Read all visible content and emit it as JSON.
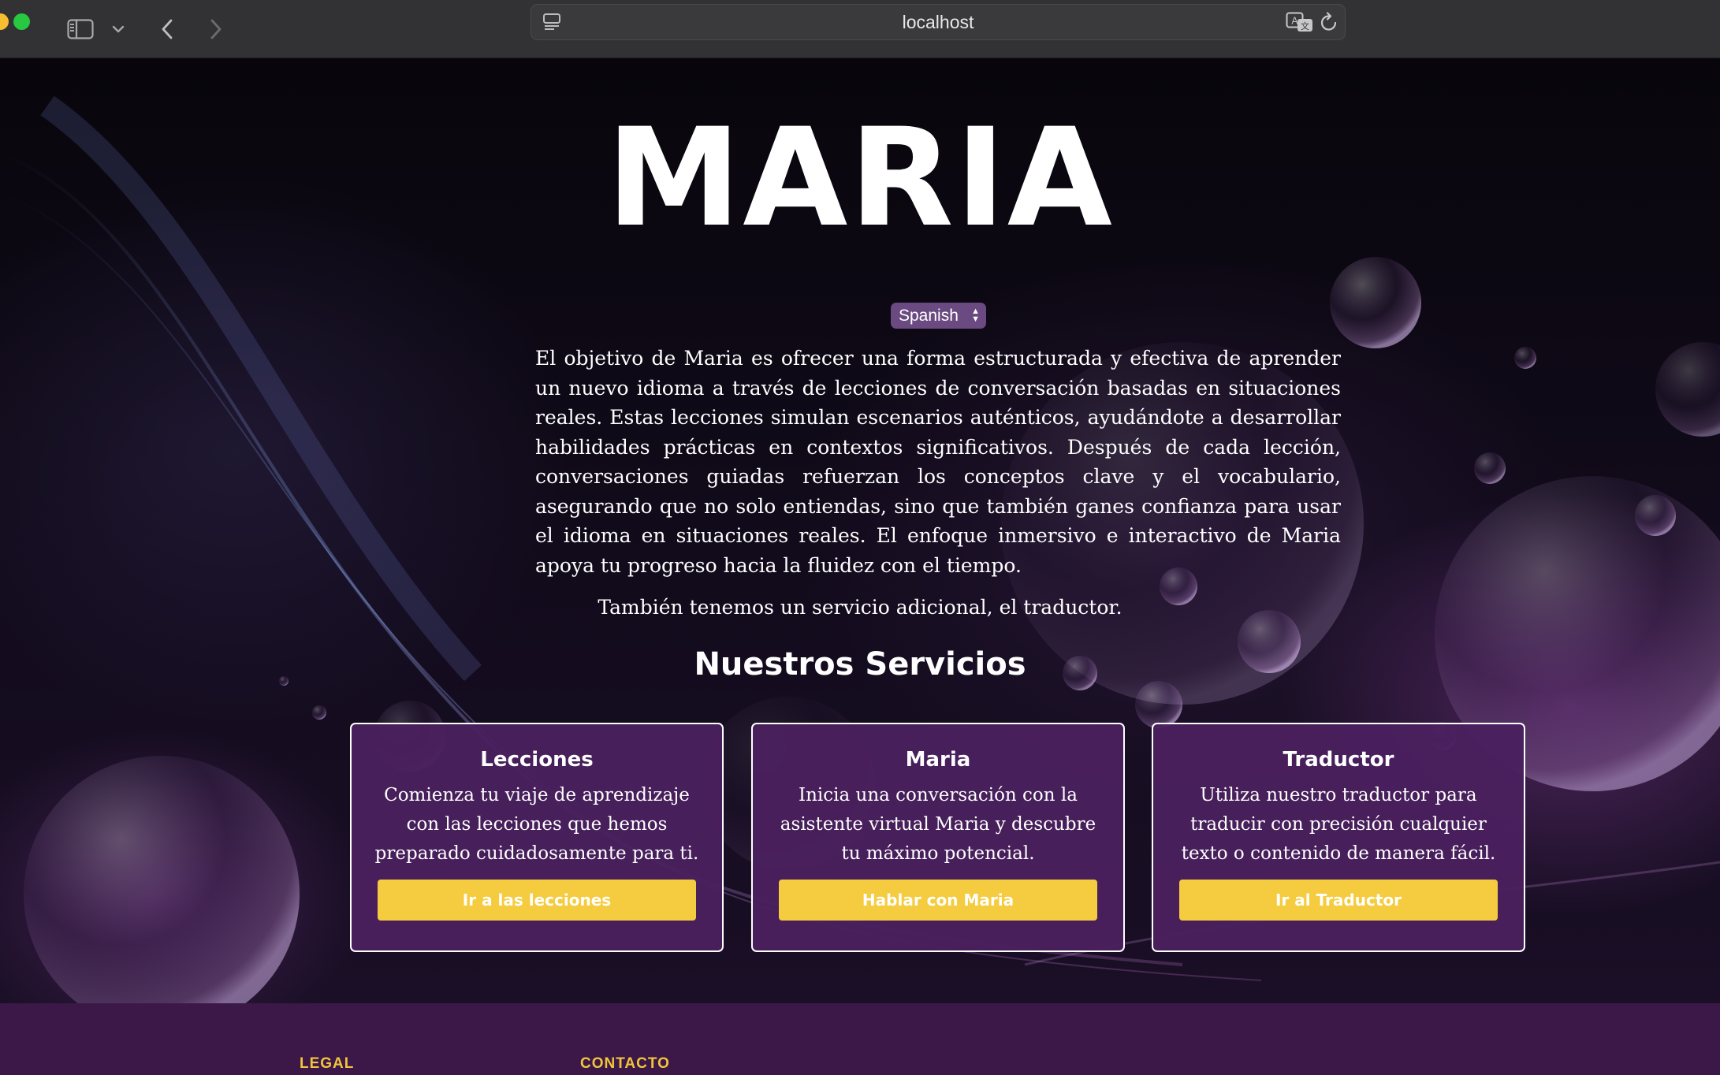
{
  "browser": {
    "url": "localhost"
  },
  "hero": {
    "title": "MARIA",
    "language_select": {
      "selected": "Spanish"
    },
    "intro": "El objetivo de Maria es ofrecer una forma estructurada y efectiva de aprender un nuevo idioma a través de lecciones de conversación basadas en situaciones reales. Estas lecciones simulan escenarios auténticos, ayudándote a desarrollar habilidades prácticas en contextos significativos. Después de cada lección, conversaciones guiadas refuerzan los conceptos clave y el vocabulario, asegurando que no solo entiendas, sino que también ganes confianza para usar el idioma en situaciones reales. El enfoque inmersivo e interactivo de Maria apoya tu progreso hacia la fluidez con el tiempo.",
    "extra_service": "También tenemos un servicio adicional, el traductor."
  },
  "services": {
    "title": "Nuestros Servicios",
    "cards": [
      {
        "title": "Lecciones",
        "description": "Comienza tu viaje de aprendizaje con las lecciones que hemos preparado cuidadosamente para ti.",
        "button": "Ir a las lecciones"
      },
      {
        "title": "Maria",
        "description": "Inicia una conversación con la asistente virtual Maria y descubre tu máximo potencial.",
        "button": "Hablar con Maria"
      },
      {
        "title": "Traductor",
        "description": "Utiliza nuestro traductor para traducir con precisión cualquier texto o contenido de manera fácil.",
        "button": "Ir al Traductor"
      }
    ]
  },
  "footer": {
    "legal": "LEGAL",
    "contact": "CONTACTO"
  },
  "colors": {
    "card_background": "#4a205e",
    "button": "#f5cc3f",
    "footer_background": "#3b1847",
    "footer_heading": "#f2c43d"
  },
  "icons": [
    "sidebar-icon",
    "chevron-down-icon",
    "back-arrow-icon",
    "forward-arrow-icon",
    "reader-icon",
    "translate-icon",
    "reload-icon"
  ]
}
